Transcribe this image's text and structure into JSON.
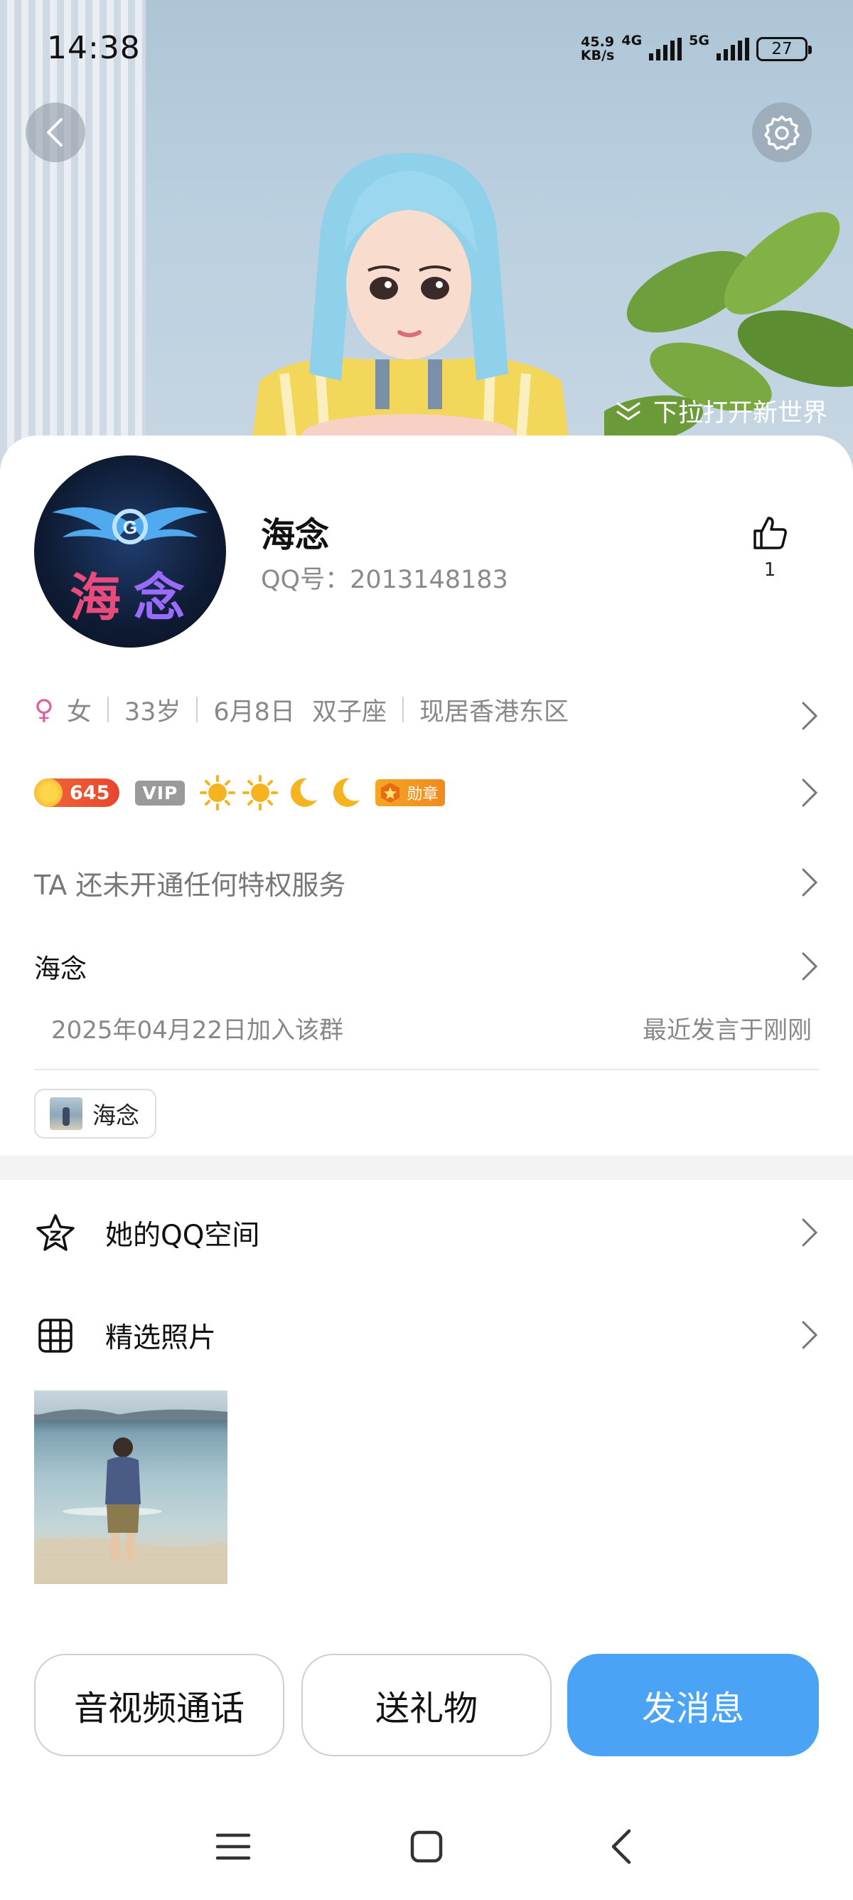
{
  "status_bar": {
    "time": "14:38",
    "net_speed_value": "45.9",
    "net_speed_unit": "KB/s",
    "sim1_type": "4G",
    "sim2_type": "5G",
    "battery": "27"
  },
  "banner": {
    "pull_hint": "下拉打开新世界",
    "icons": [
      "back-icon",
      "settings-icon",
      "double-chevron-down-icon"
    ]
  },
  "profile": {
    "name": "海念",
    "qq_label": "QQ号：2013148183",
    "likes": "1",
    "gender_symbol": "♀",
    "gender": "女",
    "age": "33岁",
    "birthday": "6月8日",
    "zodiac": "双子座",
    "location": "现居香港东区"
  },
  "badges": {
    "coin_level": "645",
    "vip": "VIP",
    "medal": "勋章",
    "level_icons": [
      "sun-icon",
      "sun-icon",
      "moon-icon",
      "moon-icon"
    ]
  },
  "privilege_text": "TA 还未开通任何特权服务",
  "group": {
    "nickname": "海念",
    "joined": "2025年04月22日加入该群",
    "last_spoke": "最近发言于刚刚",
    "tag_label": "海念"
  },
  "menu": {
    "qzone": "她的QQ空间",
    "photos": "精选照片"
  },
  "actions": {
    "call": "音视频通话",
    "gift": "送礼物",
    "message": "发消息"
  },
  "colors": {
    "accent_blue": "#4aa3f5",
    "coin_red": "#e8452b",
    "medal_orange": "#f5a623",
    "female_pink": "#e0609a"
  }
}
